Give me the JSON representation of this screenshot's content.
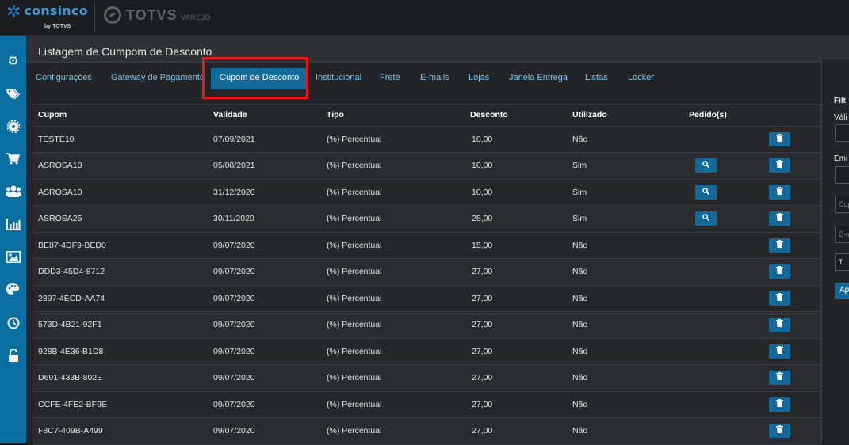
{
  "brand": {
    "name": "consinco",
    "by": "by TOTVS",
    "partner": "TOTVS",
    "partner_sub": "VAREJO"
  },
  "sidebar": {
    "icons": [
      "gear-icon",
      "tags-icon",
      "cog-badge-icon",
      "cart-icon",
      "users-icon",
      "bar-chart-icon",
      "image-icon",
      "palette-icon",
      "clock-icon",
      "unlock-icon"
    ]
  },
  "page": {
    "title": "Listagem de Cumpom de Desconto"
  },
  "tabs": [
    {
      "label": "Configurações"
    },
    {
      "label": "Gateway de Pagamento"
    },
    {
      "label": "Cupom de Desconto"
    },
    {
      "label": "Institucional"
    },
    {
      "label": "Frete"
    },
    {
      "label": "E-mails"
    },
    {
      "label": "Lojas"
    },
    {
      "label": "Janela Entrega"
    },
    {
      "label": "Listas"
    },
    {
      "label": "Locker"
    }
  ],
  "active_tab": "Cupom de Desconto",
  "colors": {
    "accent": "#126b99",
    "sidebar": "#0c6fa2",
    "highlight": "#e61a1a",
    "tab_text": "#7ec3ea"
  },
  "table": {
    "headers": {
      "cupom": "Cupom",
      "validade": "Validade",
      "tipo": "Tipo",
      "desconto": "Desconto",
      "utilizado": "Utilizado",
      "pedidos": "Pedido(s)"
    },
    "rows": [
      {
        "cupom": "TESTE10",
        "validade": "07/09/2021",
        "tipo": "(%) Percentual",
        "desconto": "10,00",
        "utilizado": "Não",
        "has_pedido": false
      },
      {
        "cupom": "ASROSA10",
        "validade": "05/08/2021",
        "tipo": "(%) Percentual",
        "desconto": "10,00",
        "utilizado": "Sim",
        "has_pedido": true
      },
      {
        "cupom": "ASROSA10",
        "validade": "31/12/2020",
        "tipo": "(%) Percentual",
        "desconto": "10,00",
        "utilizado": "Sim",
        "has_pedido": true
      },
      {
        "cupom": "ASROSA25",
        "validade": "30/11/2020",
        "tipo": "(%) Percentual",
        "desconto": "25,00",
        "utilizado": "Sim",
        "has_pedido": true
      },
      {
        "cupom": "BE87-4DF9-BED0",
        "validade": "09/07/2020",
        "tipo": "(%) Percentual",
        "desconto": "15,00",
        "utilizado": "Não",
        "has_pedido": false
      },
      {
        "cupom": "DDD3-45D4-8712",
        "validade": "09/07/2020",
        "tipo": "(%) Percentual",
        "desconto": "27,00",
        "utilizado": "Não",
        "has_pedido": false
      },
      {
        "cupom": "2897-4ECD-AA74",
        "validade": "09/07/2020",
        "tipo": "(%) Percentual",
        "desconto": "27,00",
        "utilizado": "Não",
        "has_pedido": false
      },
      {
        "cupom": "573D-4B21-92F1",
        "validade": "09/07/2020",
        "tipo": "(%) Percentual",
        "desconto": "27,00",
        "utilizado": "Não",
        "has_pedido": false
      },
      {
        "cupom": "928B-4E36-B1D8",
        "validade": "09/07/2020",
        "tipo": "(%) Percentual",
        "desconto": "27,00",
        "utilizado": "Não",
        "has_pedido": false
      },
      {
        "cupom": "D691-433B-802E",
        "validade": "09/07/2020",
        "tipo": "(%) Percentual",
        "desconto": "27,00",
        "utilizado": "Não",
        "has_pedido": false
      },
      {
        "cupom": "CCFE-4FE2-BF9E",
        "validade": "09/07/2020",
        "tipo": "(%) Percentual",
        "desconto": "27,00",
        "utilizado": "Não",
        "has_pedido": false
      },
      {
        "cupom": "F8C7-409B-A499",
        "validade": "09/07/2020",
        "tipo": "(%) Percentual",
        "desconto": "27,00",
        "utilizado": "Não",
        "has_pedido": false
      }
    ]
  },
  "filter_panel": {
    "title": "Filt",
    "validade_label": "Váli",
    "emissao_label": "Emi",
    "cupom_placeholder": "Cup",
    "email_placeholder": "E-m",
    "select_value": "T",
    "apply_label": "Ap"
  }
}
